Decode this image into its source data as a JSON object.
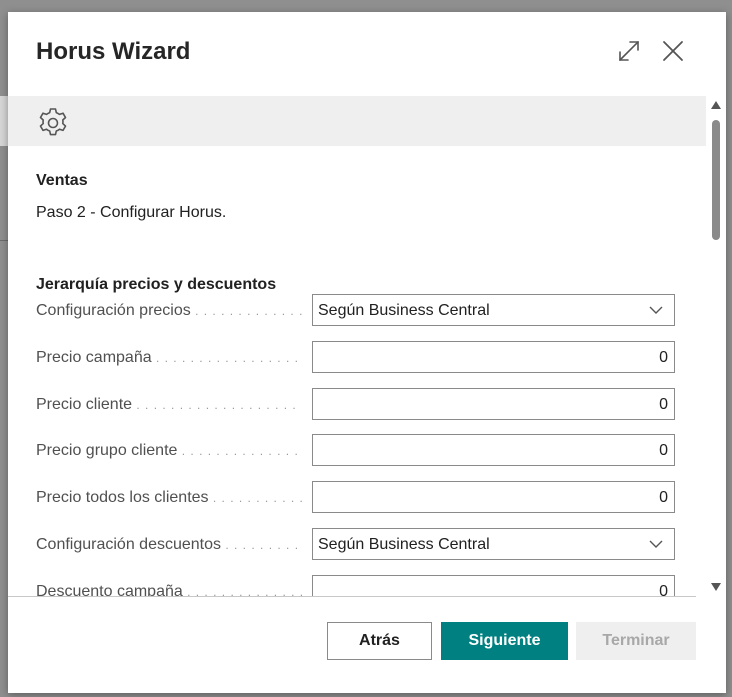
{
  "dialog": {
    "title": "Horus Wizard"
  },
  "step": {
    "section_title": "Ventas",
    "description": "Paso 2 - Configurar Horus."
  },
  "group": {
    "title": "Jerarquía precios y descuentos",
    "fields": [
      {
        "label": "Configuración precios",
        "value": "Según Business Central",
        "type": "select"
      },
      {
        "label": "Precio campaña",
        "value": "0",
        "type": "number"
      },
      {
        "label": "Precio cliente",
        "value": "0",
        "type": "number"
      },
      {
        "label": "Precio grupo cliente",
        "value": "0",
        "type": "number"
      },
      {
        "label": "Precio todos los clientes",
        "value": "0",
        "type": "number"
      },
      {
        "label": "Configuración descuentos",
        "value": "Según Business Central",
        "type": "select"
      },
      {
        "label": "Descuento campaña",
        "value": "0",
        "type": "number"
      }
    ]
  },
  "footer": {
    "back_label": "Atrás",
    "next_label": "Siguiente",
    "finish_label": "Terminar"
  },
  "colors": {
    "accent": "#008080",
    "disabled_text": "#a8a8a8",
    "band": "#efefef"
  },
  "icons": {
    "header": [
      "expand-icon",
      "close-icon"
    ],
    "band": "gear-icon",
    "field_select": "chevron-down-icon"
  }
}
